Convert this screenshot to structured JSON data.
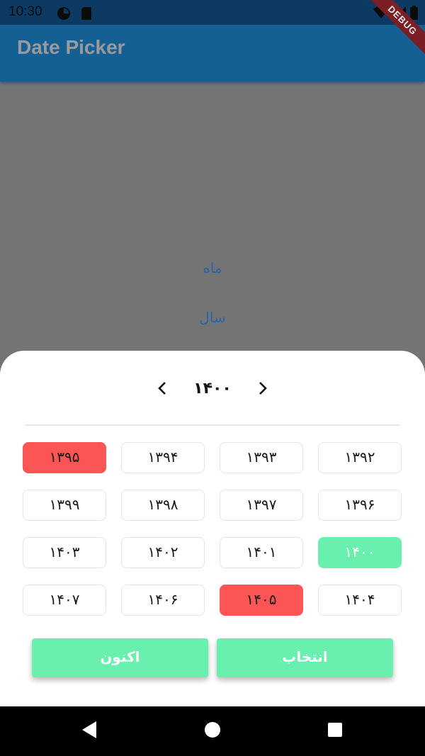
{
  "status_bar": {
    "time": "10:30",
    "icons": [
      "pie-chart-icon",
      "sd-card-icon",
      "wifi-icon",
      "signal-icon",
      "battery-icon"
    ]
  },
  "app_bar": {
    "title": "Date Picker"
  },
  "debug_banner": {
    "label": "DEBUG"
  },
  "background": {
    "month_link": "ماه",
    "year_link": "سال"
  },
  "picker": {
    "current_year": "۱۴۰۰",
    "prev_icon": "chevron-left-icon",
    "next_icon": "chevron-right-icon",
    "rows": [
      [
        "۱۳۹۵",
        "۱۳۹۴",
        "۱۳۹۳",
        "۱۳۹۲"
      ],
      [
        "۱۳۹۹",
        "۱۳۹۸",
        "۱۳۹۷",
        "۱۳۹۶"
      ],
      [
        "۱۴۰۳",
        "۱۴۰۲",
        "۱۴۰۱",
        "۱۴۰۰"
      ],
      [
        "۱۴۰۷",
        "۱۴۰۶",
        "۱۴۰۵",
        "۱۴۰۴"
      ]
    ],
    "now_label": "اکنون",
    "select_label": "انتخاب"
  },
  "colors": {
    "app_bar": "#145f93",
    "red_highlight": "#fc5555",
    "green_highlight": "#69f0ae",
    "link": "#2a63a4"
  },
  "nav_bar": {
    "back_icon": "back-triangle-icon",
    "home_icon": "home-circle-icon",
    "recents_icon": "recents-square-icon"
  }
}
